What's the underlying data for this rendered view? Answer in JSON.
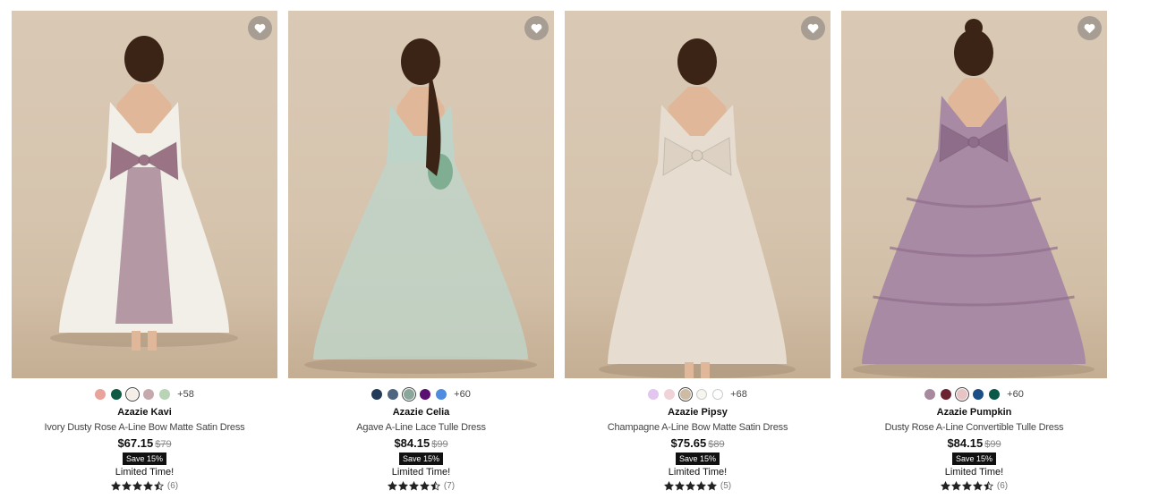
{
  "products": [
    {
      "brand": "Azazie Kavi",
      "description": "Ivory Dusty Rose A-Line Bow Matte Satin Dress",
      "price": "$67.15",
      "original_price": "$79",
      "badge": "Save 15%",
      "promo": "Limited Time!",
      "rating": 4.5,
      "review_count": "(6)",
      "more_colors": "+58",
      "swatches": [
        {
          "color": "#e8a39b"
        },
        {
          "color": "#0f5a43"
        },
        {
          "color": "#f5eee6",
          "selected": true
        },
        {
          "color": "#c6a9ac"
        },
        {
          "color": "#b8d3b5"
        }
      ],
      "dress_colors": {
        "main": "#f2efe9",
        "accent": "#9a7385",
        "skin": "#e0b899",
        "hair": "#3b2416"
      },
      "icon": "heart-icon"
    },
    {
      "brand": "Azazie Celia",
      "description": "Agave A-Line Lace Tulle Dress",
      "price": "$84.15",
      "original_price": "$99",
      "badge": "Save 15%",
      "promo": "Limited Time!",
      "rating": 4.5,
      "review_count": "(7)",
      "more_colors": "+60",
      "swatches": [
        {
          "color": "#233a58"
        },
        {
          "color": "#4e6582"
        },
        {
          "color": "#8aa79c",
          "selected": true
        },
        {
          "color": "#5a1070"
        },
        {
          "color": "#4f8ce0"
        }
      ],
      "dress_colors": {
        "main": "#bfd4c8",
        "accent": "#7fae92",
        "skin": "#e0b899",
        "hair": "#3b2416"
      },
      "icon": "heart-icon"
    },
    {
      "brand": "Azazie Pipsy",
      "description": "Champagne A-Line Bow Matte Satin Dress",
      "price": "$75.65",
      "original_price": "$89",
      "badge": "Save 15%",
      "promo": "Limited Time!",
      "rating": 5,
      "review_count": "(5)",
      "more_colors": "+68",
      "swatches": [
        {
          "color": "#e2c6ef"
        },
        {
          "color": "#efd3d9"
        },
        {
          "color": "#cdbba4",
          "selected": true
        },
        {
          "color": "#f6f5ee"
        },
        {
          "color": "#ffffff"
        }
      ],
      "dress_colors": {
        "main": "#e6ddd0",
        "accent": "#dcd1c2",
        "skin": "#e0b899",
        "hair": "#3b2416"
      },
      "icon": "heart-icon"
    },
    {
      "brand": "Azazie Pumpkin",
      "description": "Dusty Rose A-Line Convertible Tulle Dress",
      "price": "$84.15",
      "original_price": "$99",
      "badge": "Save 15%",
      "promo": "Limited Time!",
      "rating": 4.5,
      "review_count": "(6)",
      "more_colors": "+60",
      "swatches": [
        {
          "color": "#a78a9e"
        },
        {
          "color": "#6b2432"
        },
        {
          "color": "#e9c4c4",
          "selected": true
        },
        {
          "color": "#1d4f87"
        },
        {
          "color": "#0a5948"
        }
      ],
      "dress_colors": {
        "main": "#a98aa4",
        "accent": "#8e6d8a",
        "skin": "#e0b899",
        "hair": "#3b2416"
      },
      "icon": "heart-icon"
    }
  ]
}
